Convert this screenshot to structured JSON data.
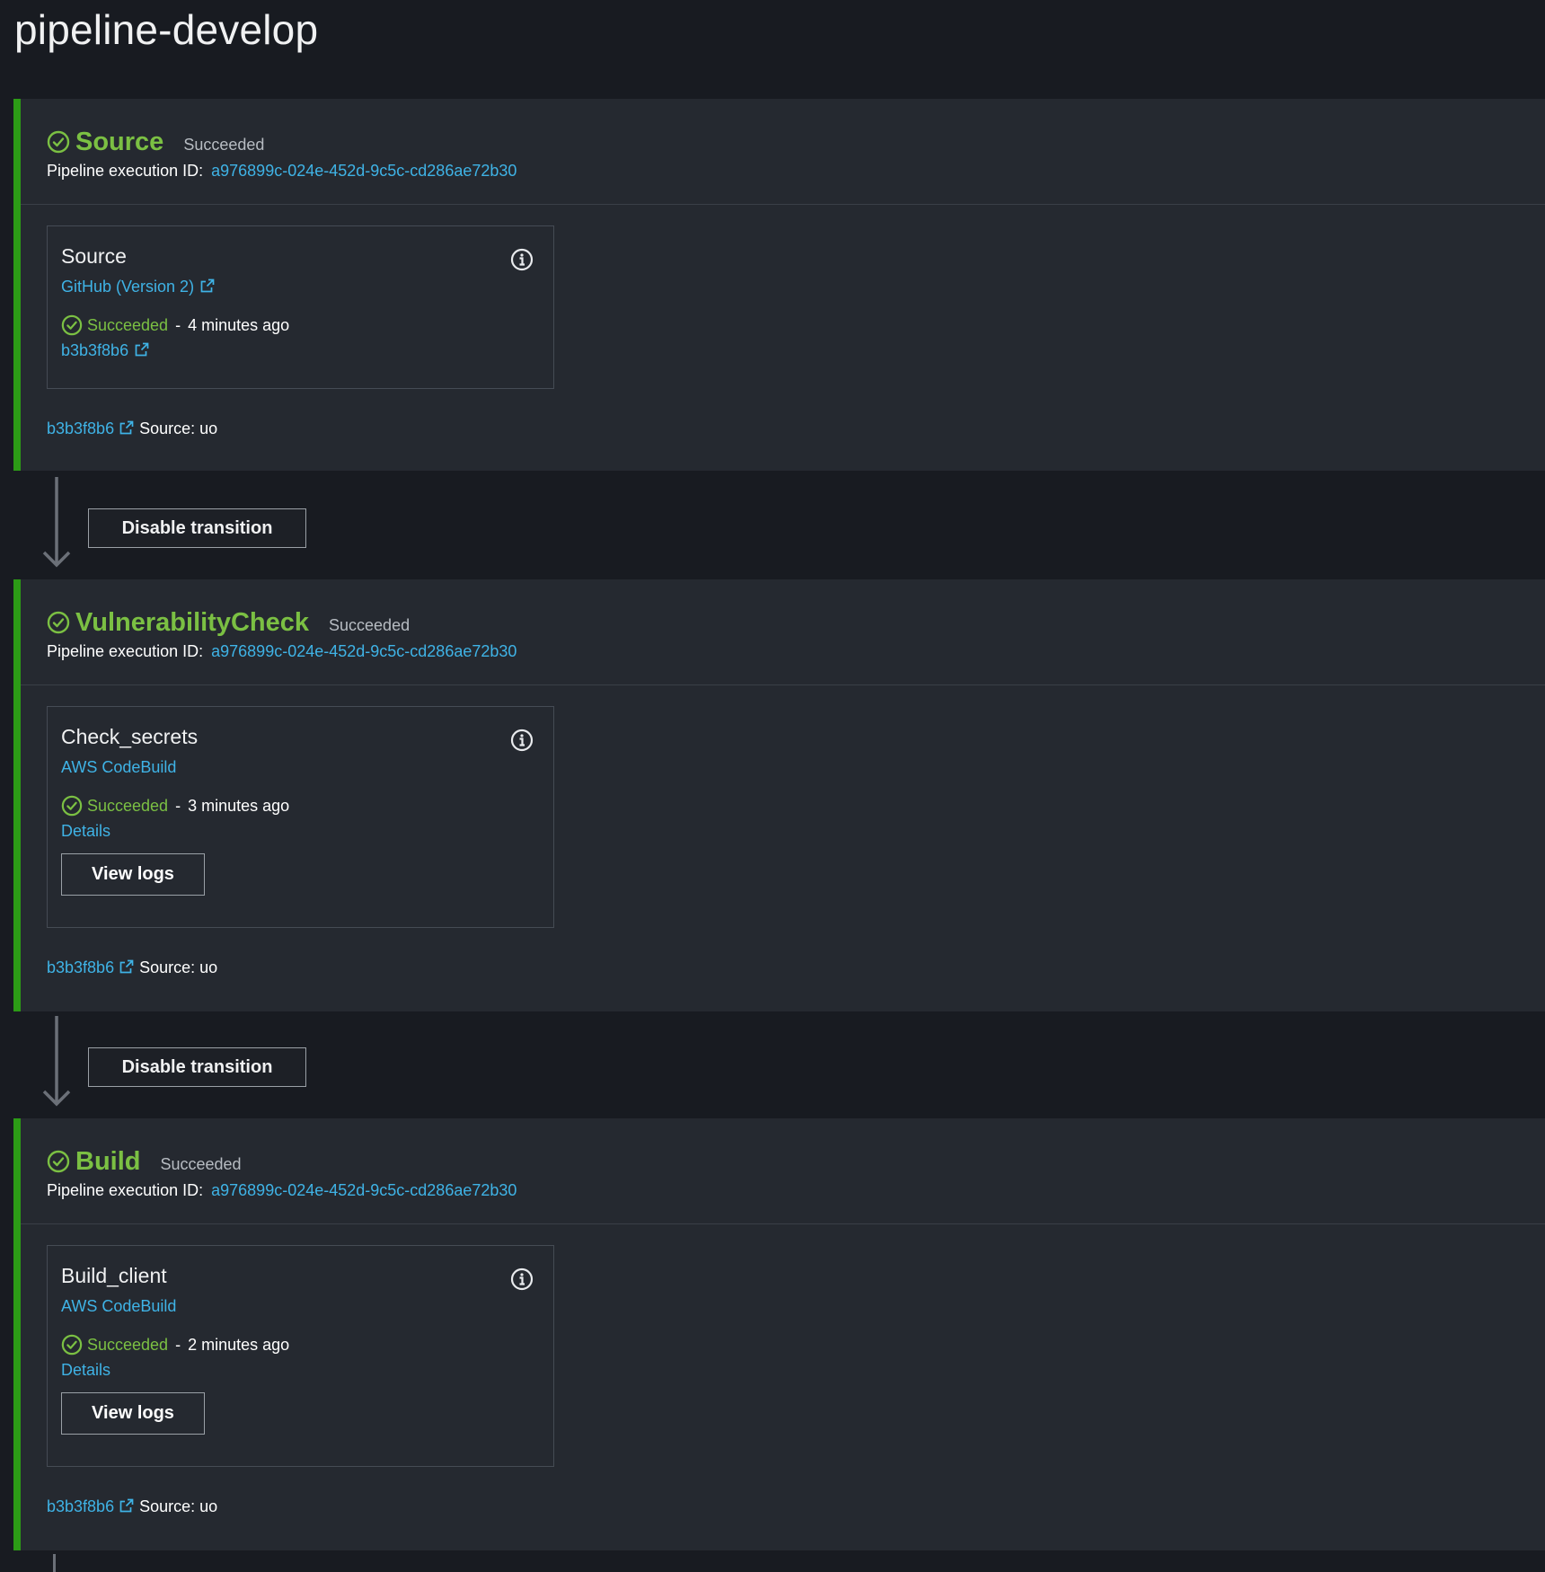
{
  "page": {
    "title": "pipeline-develop"
  },
  "labels": {
    "exec_id_label": "Pipeline execution ID:",
    "disable_transition": "Disable transition",
    "view_logs": "View logs",
    "details": "Details",
    "sep": "-"
  },
  "colors": {
    "success": "#7bc043",
    "link": "#3fb3e6",
    "stage_bar": "#2c9b16"
  },
  "icons": {
    "status": "check-circle-icon",
    "info": "info-circle-icon",
    "external": "external-link-icon",
    "arrow": "arrow-down-icon"
  },
  "stages": [
    {
      "name": "Source",
      "status": "Succeeded",
      "execution_id": "a976899c-024e-452d-9c5c-cd286ae72b30",
      "action": {
        "name": "Source",
        "provider": "GitHub (Version 2)",
        "status": "Succeeded",
        "time": "4 minutes ago",
        "link": "b3b3f8b6"
      },
      "artifact": {
        "revision": "b3b3f8b6",
        "source": "Source: uo"
      }
    },
    {
      "name": "VulnerabilityCheck",
      "status": "Succeeded",
      "execution_id": "a976899c-024e-452d-9c5c-cd286ae72b30",
      "action": {
        "name": "Check_secrets",
        "provider": "AWS CodeBuild",
        "status": "Succeeded",
        "time": "3 minutes ago",
        "link": "Details"
      },
      "artifact": {
        "revision": "b3b3f8b6",
        "source": "Source: uo"
      }
    },
    {
      "name": "Build",
      "status": "Succeeded",
      "execution_id": "a976899c-024e-452d-9c5c-cd286ae72b30",
      "action": {
        "name": "Build_client",
        "provider": "AWS CodeBuild",
        "status": "Succeeded",
        "time": "2 minutes ago",
        "link": "Details"
      },
      "artifact": {
        "revision": "b3b3f8b6",
        "source": "Source: uo"
      }
    }
  ]
}
